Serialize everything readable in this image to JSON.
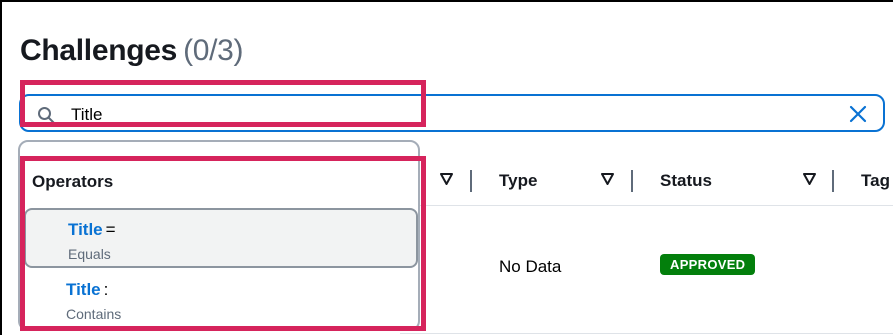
{
  "page": {
    "title": "Challenges",
    "count": "(0/3)"
  },
  "search": {
    "value": "Title"
  },
  "table": {
    "columns": [
      {
        "label": "Type"
      },
      {
        "label": "Status"
      },
      {
        "label": "Tag"
      }
    ],
    "rows": [
      {
        "type": "No Data",
        "status": "APPROVED"
      }
    ]
  },
  "dropdown": {
    "header": "Operators",
    "options": [
      {
        "property": "Title",
        "operator": "=",
        "description": "Equals"
      },
      {
        "property": "Title",
        "operator": ":",
        "description": "Contains"
      }
    ]
  },
  "colors": {
    "accent": "#0972d3",
    "status_approved": "#037f0c",
    "annotation": "#d6245c"
  },
  "icons": [
    "search-icon",
    "clear-icon",
    "sort-icon"
  ]
}
